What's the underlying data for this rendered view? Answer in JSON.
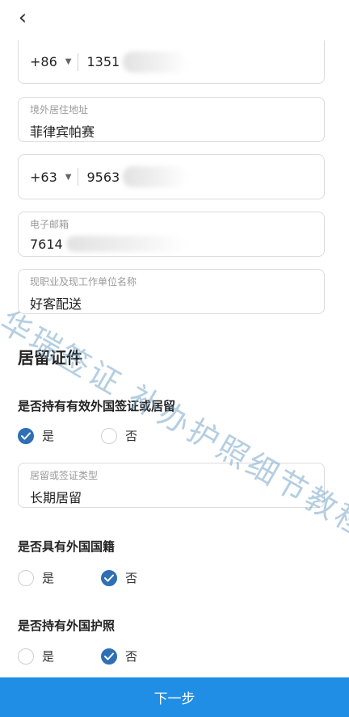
{
  "nav": {
    "back_icon": "chevron-left-icon",
    "back_glyph": "‹"
  },
  "phone_cn": {
    "country_code": "+86",
    "number_prefix": "1351"
  },
  "overseas_address": {
    "label": "境外居住地址",
    "value": "菲律宾帕赛"
  },
  "phone_ph": {
    "country_code": "+63",
    "number_prefix": "9563"
  },
  "email": {
    "label": "电子邮箱",
    "value_prefix": "7614"
  },
  "occupation": {
    "label": "现职业及现工作单位名称",
    "value": "好客配送"
  },
  "residence_section": {
    "title": "居留证件",
    "q1": {
      "text": "是否持有有效外国签证或居留",
      "yes": "是",
      "no": "否",
      "selected": "yes"
    },
    "visa_type": {
      "label": "居留或签证类型",
      "value": "长期居留"
    },
    "q2": {
      "text": "是否具有外国国籍",
      "yes": "是",
      "no": "否",
      "selected": "no"
    },
    "q3": {
      "text": "是否持有外国护照",
      "yes": "是",
      "no": "否",
      "selected": "no"
    }
  },
  "footer": {
    "next_label": "下一步"
  },
  "watermark": "华瑞签证 补办护照细节教程",
  "colors": {
    "accent": "#1f8ee4",
    "radio_checked": "#2f6fb4",
    "border": "#dcdcdc"
  }
}
